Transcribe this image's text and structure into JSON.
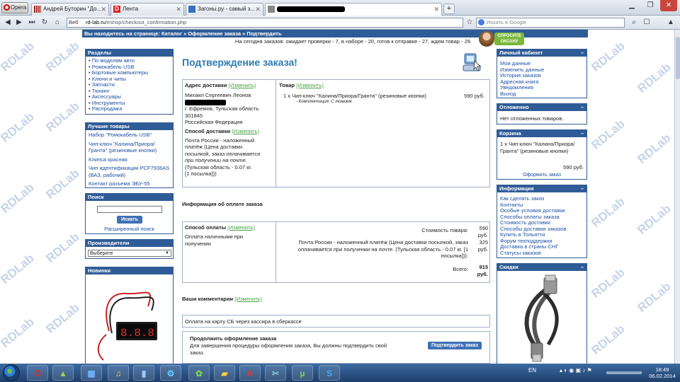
{
  "browser": {
    "menu_label": "Opera",
    "tabs": [
      {
        "title": "Андрей Буторин \"До..."
      },
      {
        "title": "Лента"
      },
      {
        "title": "Загоны.ру - самый з..."
      }
    ],
    "new_tab": "+",
    "address_label": "Веб",
    "url_host": "rd-lab.ru",
    "url_path": "/eshop/checkout_confirmation.php",
    "search_placeholder": "Искать в Google"
  },
  "site": {
    "breadcrumb": "Вы находитесь на странице: Каталог » Оформление заказа » Подтвердить",
    "orders_status": "На сегодня заказов: ожидает проверки - 7, в наборе - 20, готов к отправке - 27, ждем товар - 29.",
    "ask_button": "СПРОСИТЕ ОКСАНУ",
    "watermark": "RDLab"
  },
  "left": {
    "sections_title": "Разделы",
    "sections": [
      "По моделям авто",
      "Ромокабель USB",
      "Бортовые компьютеры",
      "Ключи и чипы",
      "Запчасти",
      "Тюнинг",
      "Аксессуары",
      "Инструменты",
      "Распродажа"
    ],
    "best_title": "Лучшие товары",
    "best": [
      "Набор \"Ромокабель USB\"",
      "Чип-ключ \"Калина/Приора/Гранта\" (резиновые кнопки)",
      "Клипса красная",
      "Чип идентификации PCF7936AS (ВАЗ, рабочий)",
      "Контакт разъема ЭБУ-55"
    ],
    "search_title": "Поиск",
    "search_button": "Искать",
    "advanced_search": "Расширенный поиск",
    "manufacturers_title": "Производители",
    "manufacturers_select": "Выберите",
    "new_title": "Новинки"
  },
  "main": {
    "title": "Подтверждение заказа!",
    "edit": "(Изменить)",
    "shipping_address_label": "Адрес доставки",
    "address": [
      "Михаил Сергеевич Леонов",
      "г. Ефремов, Тульская область",
      "301845",
      "Российская Федерация"
    ],
    "shipping_method_label": "Способ доставки",
    "shipping_method_text": [
      "Почта России - наложенный",
      "платёж (Цена доставки",
      "посылкой, заказ оплачивается"
    ],
    "shipping_method_italic": "при получении на почте",
    "shipping_method_tail": [
      "(Тульская область - 0.07 кг.",
      "[1 посылка]))"
    ],
    "product_label": "Товар",
    "product_qty": "1 x",
    "product_name": "Чип-ключ \"Калина/Приора/Гранта\" (резиновые кнопки)",
    "product_price": "590 руб.",
    "product_option": "- Комплектация: С лезвием",
    "payment_info_title": "Информация об оплате заказа",
    "payment_method_label": "Способ оплаты",
    "payment_method_text": [
      "Оплата наличными при",
      "получении"
    ],
    "totals": [
      {
        "label": "Стоимость товара:",
        "value": "590 руб."
      },
      {
        "label": "Почта России - наложенный платёж (Цена доставки посылкой, заказ оплачивается при получении на почте. (Тульская область - 0.07 кг. [1 посылка])):",
        "value": "325 руб."
      },
      {
        "label": "Всего:",
        "value": "915 руб."
      }
    ],
    "comments_label": "Ваши комментарии",
    "comment": "Оплата на карту СБ через кассира в сберкассе",
    "continue_title": "Продолжить оформление заказа",
    "continue_text": "Для завершения процедуры оформления заказа, Вы должны подтвердить свой заказ.",
    "confirm_button": "Подтвердить заказ"
  },
  "right": {
    "account_title": "Личный кабинет",
    "account": [
      "Мои данные",
      "Изменить данные",
      "История заказов",
      "Адресная книга",
      "Уведомления",
      "Выход"
    ],
    "deferred_title": "Отложенно",
    "deferred_text": "Нет отложенных товаров.",
    "cart_title": "Корзина",
    "cart_item": "1 x Чип-ключ \"Калина/Приора/Гранта\" (резиновые кнопки)",
    "cart_total": "590 руб.",
    "cart_checkout": "Оформить заказ",
    "info_title": "Информация",
    "info": [
      "Как сделать заказ",
      "Контакты",
      "Особые условия доставки",
      "Способы оплаты заказа",
      "Стоимость доставки",
      "Способы доставки заказов",
      "Купить в Тольятти",
      "Форум техподдержки",
      "Доставка в страны СНГ",
      "Статусы заказов"
    ],
    "skidki_title": "Скидки",
    "collapse": "–"
  },
  "taskbar": {
    "lang": "EN",
    "time": "18:49",
    "date": "06.02.2014"
  }
}
